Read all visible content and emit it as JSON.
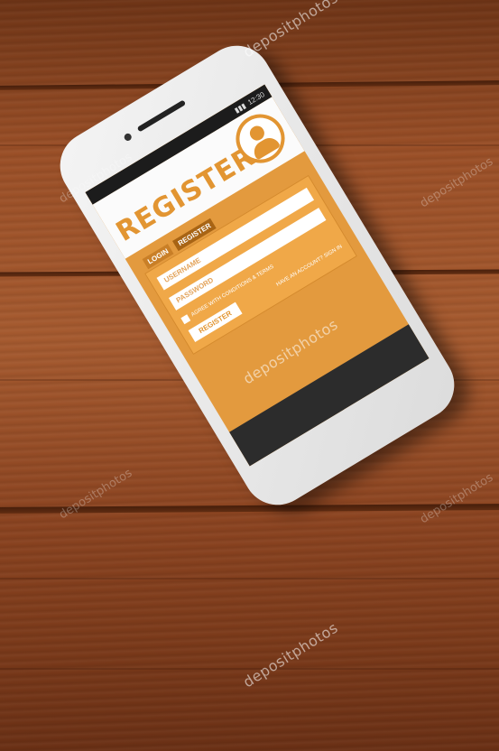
{
  "scene": "smartphone-on-wooden-table",
  "phone": {
    "status_time": "12:30",
    "header_title": "REGISTER",
    "avatar_icon": "user-avatar-icon",
    "tabs": [
      {
        "label": "LOGIN"
      },
      {
        "label": "REGISTER"
      }
    ],
    "username_placeholder": "USERNAME",
    "password_placeholder": "PASSWORD",
    "agree_label": "AGREE WITH CONDITIONS & TERMS",
    "register_button": "REGISTER",
    "signin_text": "HAVE AN ACCOUNT? SIGN IN",
    "accent_color": "#e29532"
  },
  "watermarks": [
    {
      "text": "depositphotos"
    },
    {
      "text": "depositphotos"
    },
    {
      "text": "depositphotos"
    },
    {
      "text": "depositphotos"
    },
    {
      "text": "depositphotos"
    },
    {
      "text": "depositphotos"
    },
    {
      "text": "depositphotos"
    }
  ]
}
